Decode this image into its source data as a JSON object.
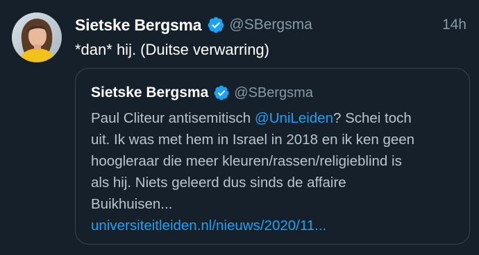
{
  "tweet": {
    "author_name": "Sietske Bergsma",
    "author_handle": "@SBergsma",
    "timestamp": "14h",
    "text": "*dan* hij. (Duitse verwarring)",
    "verified_icon": "verified-badge-icon"
  },
  "quoted_tweet": {
    "author_name": "Sietske Bergsma",
    "author_handle": "@SBergsma",
    "body_lines": [
      {
        "before": "Paul Cliteur antisemitisch ",
        "mention": "@UniLeiden",
        "after": "? Schei toch"
      },
      {
        "text": "uit. Ik was met hem in Israel in 2018 en ik ken geen"
      },
      {
        "text": "hoogleraar die meer kleuren/rassen/religieblind is"
      },
      {
        "text": "als hij. Niets geleerd dus sinds de affaire"
      },
      {
        "text": "Buikhuisen..."
      }
    ],
    "link": "universiteitleiden.nl/nieuws/2020/11..."
  },
  "colors": {
    "background": "#15202b",
    "accent": "#1da1f2",
    "secondary_text": "#8899a6",
    "border": "#38444d"
  }
}
